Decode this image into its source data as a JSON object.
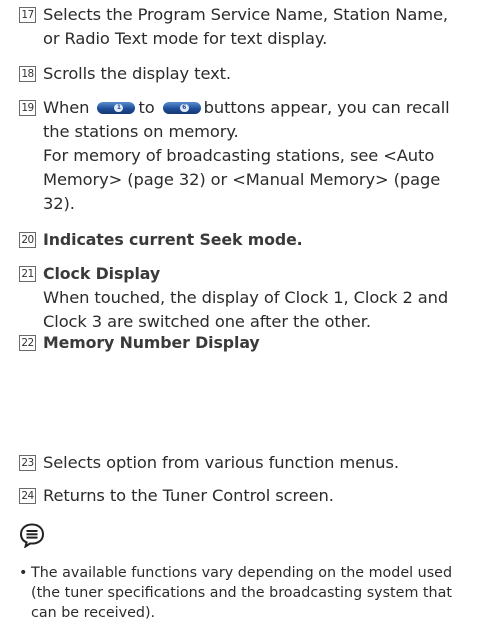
{
  "items": [
    {
      "num": "17",
      "lines": [
        "Selects the Program Service Name, Station Name,",
        "or Radio Text mode for text display."
      ]
    },
    {
      "num": "18",
      "lines": [
        "Scrolls the display text."
      ]
    },
    {
      "num": "19",
      "line1_before": "When",
      "button_first": "1",
      "line1_mid": "to",
      "button_last": "6",
      "line1_after": "buttons appear, you can recall",
      "lines_rest": [
        "the stations on memory.",
        "For memory of broadcasting stations, see <Auto",
        "Memory> (page 32) or <Manual Memory> (page",
        "32)."
      ]
    },
    {
      "num": "20",
      "lines": [
        "Indicates current Seek mode."
      ]
    },
    {
      "num": "21",
      "title": "Clock Display",
      "lines": [
        "When touched, the display of Clock 1, Clock 2 and",
        "Clock 3 are switched one after the other."
      ]
    },
    {
      "num": "22",
      "title": "Memory Number Display"
    },
    {
      "num": "23",
      "lines": [
        "Selects option from various function menus."
      ]
    },
    {
      "num": "24",
      "lines": [
        "Returns to the Tuner Control screen."
      ]
    }
  ],
  "note": {
    "icon": "note-bubble-icon",
    "bullet": "•",
    "lines": [
      "The available functions vary depending on the model used",
      "(the tuner specifications and the broadcasting system that",
      "can be received)."
    ]
  }
}
